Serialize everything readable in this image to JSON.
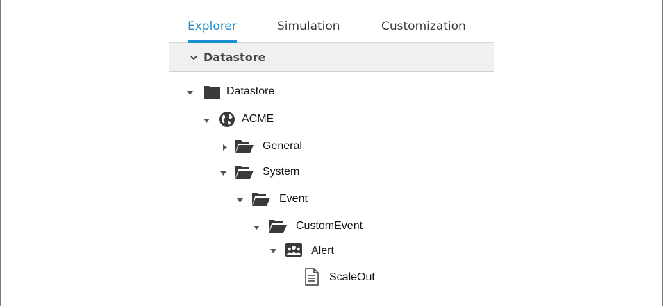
{
  "tabs": [
    {
      "label": "Explorer",
      "active": true
    },
    {
      "label": "Simulation",
      "active": false
    },
    {
      "label": "Customization",
      "active": false
    }
  ],
  "accent_color": "#1a8fd0",
  "section": {
    "label": "Datastore",
    "icon": "chevron-down-icon"
  },
  "tree": [
    {
      "label": "Datastore",
      "icon": "folder-closed-icon",
      "expanded": true
    },
    {
      "label": "ACME",
      "icon": "globe-icon",
      "expanded": true
    },
    {
      "label": "General",
      "icon": "folder-open-icon",
      "expanded": false
    },
    {
      "label": "System",
      "icon": "folder-open-icon",
      "expanded": true
    },
    {
      "label": "Event",
      "icon": "folder-open-icon",
      "expanded": true
    },
    {
      "label": "CustomEvent",
      "icon": "folder-open-icon",
      "expanded": true
    },
    {
      "label": "Alert",
      "icon": "group-icon",
      "expanded": true
    },
    {
      "label": "ScaleOut",
      "icon": "document-icon",
      "expanded": null
    }
  ]
}
